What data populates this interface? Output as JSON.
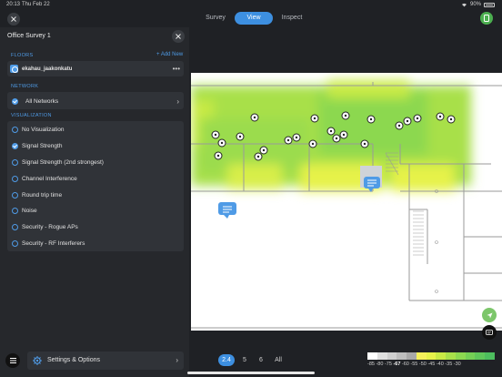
{
  "status_bar": {
    "time": "20:13",
    "date": "Thu Feb 22",
    "battery": "90%"
  },
  "top_tabs": [
    {
      "label": "Survey",
      "active": false
    },
    {
      "label": "View",
      "active": true
    },
    {
      "label": "Inspect",
      "active": false
    }
  ],
  "profile_initial": "",
  "panel": {
    "title": "Office Survey 1",
    "floors_label": "FLOORS",
    "add_new": "+ Add New",
    "floor_name": "ekahau_jaakonkatu",
    "network_label": "NETWORK",
    "network_value": "All Networks",
    "visualization_label": "VISUALIZATION",
    "visualizations": [
      {
        "label": "No Visualization",
        "selected": false
      },
      {
        "label": "Signal Strength",
        "selected": true
      },
      {
        "label": "Signal Strength (2nd strongest)",
        "selected": false
      },
      {
        "label": "Channel Interference",
        "selected": false
      },
      {
        "label": "Round trip time",
        "selected": false
      },
      {
        "label": "Noise",
        "selected": false
      },
      {
        "label": "Security - Rogue APs",
        "selected": false
      },
      {
        "label": "Security - RF Interferers",
        "selected": false
      }
    ],
    "settings_label": "Settings & Options"
  },
  "bands": [
    {
      "label": "2.4",
      "active": true
    },
    {
      "label": "5",
      "active": false
    },
    {
      "label": "6",
      "active": false
    },
    {
      "label": "All",
      "active": false
    }
  ],
  "legend": {
    "labels_left": "-85 -80 -75",
    "current": "-67",
    "labels_right": "-60 -55 -50 -45 -40 -35 -30",
    "colors": [
      "#ffffff",
      "#e0e0e0",
      "#cfcfcf",
      "#bdbdbd",
      "#a8a8a8",
      "#f4f05a",
      "#e6f24a",
      "#c8ea45",
      "#a8e04a",
      "#8cd850",
      "#74cf55",
      "#5fc65a",
      "#4dbd5e"
    ]
  },
  "icons": {
    "close": "close-icon",
    "menu": "hamburger-menu-icon",
    "settings": "gear-icon",
    "chevron": "chevron-right-icon",
    "more": "more-horizontal-icon",
    "ap": "access-point-icon",
    "comment": "comment-bubble-icon"
  }
}
